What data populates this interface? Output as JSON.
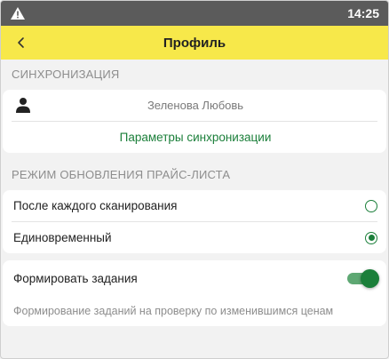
{
  "status_bar": {
    "time": "14:25",
    "warning_icon": "warning-icon"
  },
  "app_bar": {
    "back_icon": "chevron-left-icon",
    "title": "Профиль"
  },
  "sync_section": {
    "header": "СИНХРОНИЗАЦИЯ",
    "user_icon": "user-icon",
    "user_name": "Зеленова Любовь",
    "settings_link": "Параметры синхронизации"
  },
  "price_update_section": {
    "header": "РЕЖИМ ОБНОВЛЕНИЯ ПРАЙС-ЛИСТА",
    "options": [
      {
        "label": "После каждого сканирования",
        "selected": false
      },
      {
        "label": "Единовременный",
        "selected": true
      }
    ]
  },
  "tasks_section": {
    "toggle_label": "Формировать задания",
    "toggle_on": true,
    "description": "Формирование заданий на проверку по изменившимся ценам"
  },
  "colors": {
    "app_bar": "#f7e84a",
    "status_bar": "#5b5b5b",
    "accent_green": "#1b7f3a",
    "background": "#f2f2f2"
  }
}
